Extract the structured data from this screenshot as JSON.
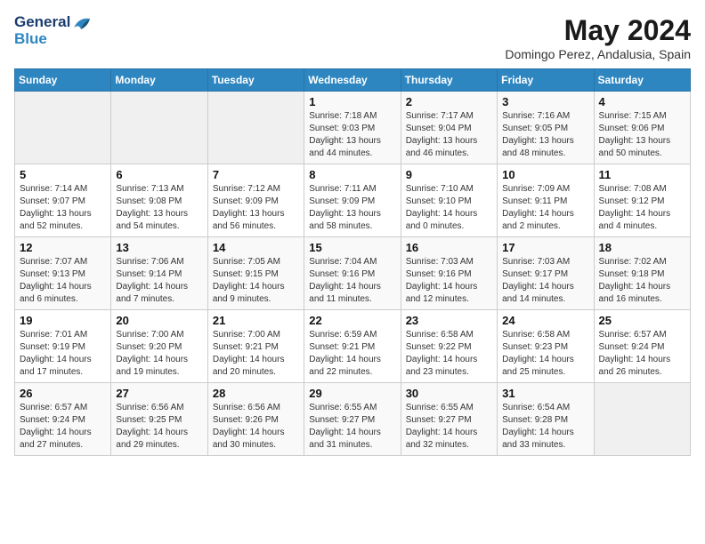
{
  "header": {
    "logo_line1": "General",
    "logo_line2": "Blue",
    "month_title": "May 2024",
    "subtitle": "Domingo Perez, Andalusia, Spain"
  },
  "weekdays": [
    "Sunday",
    "Monday",
    "Tuesday",
    "Wednesday",
    "Thursday",
    "Friday",
    "Saturday"
  ],
  "weeks": [
    [
      {
        "day": "",
        "sunrise": "",
        "sunset": "",
        "daylight": ""
      },
      {
        "day": "",
        "sunrise": "",
        "sunset": "",
        "daylight": ""
      },
      {
        "day": "",
        "sunrise": "",
        "sunset": "",
        "daylight": ""
      },
      {
        "day": "1",
        "sunrise": "Sunrise: 7:18 AM",
        "sunset": "Sunset: 9:03 PM",
        "daylight": "Daylight: 13 hours and 44 minutes."
      },
      {
        "day": "2",
        "sunrise": "Sunrise: 7:17 AM",
        "sunset": "Sunset: 9:04 PM",
        "daylight": "Daylight: 13 hours and 46 minutes."
      },
      {
        "day": "3",
        "sunrise": "Sunrise: 7:16 AM",
        "sunset": "Sunset: 9:05 PM",
        "daylight": "Daylight: 13 hours and 48 minutes."
      },
      {
        "day": "4",
        "sunrise": "Sunrise: 7:15 AM",
        "sunset": "Sunset: 9:06 PM",
        "daylight": "Daylight: 13 hours and 50 minutes."
      }
    ],
    [
      {
        "day": "5",
        "sunrise": "Sunrise: 7:14 AM",
        "sunset": "Sunset: 9:07 PM",
        "daylight": "Daylight: 13 hours and 52 minutes."
      },
      {
        "day": "6",
        "sunrise": "Sunrise: 7:13 AM",
        "sunset": "Sunset: 9:08 PM",
        "daylight": "Daylight: 13 hours and 54 minutes."
      },
      {
        "day": "7",
        "sunrise": "Sunrise: 7:12 AM",
        "sunset": "Sunset: 9:09 PM",
        "daylight": "Daylight: 13 hours and 56 minutes."
      },
      {
        "day": "8",
        "sunrise": "Sunrise: 7:11 AM",
        "sunset": "Sunset: 9:09 PM",
        "daylight": "Daylight: 13 hours and 58 minutes."
      },
      {
        "day": "9",
        "sunrise": "Sunrise: 7:10 AM",
        "sunset": "Sunset: 9:10 PM",
        "daylight": "Daylight: 14 hours and 0 minutes."
      },
      {
        "day": "10",
        "sunrise": "Sunrise: 7:09 AM",
        "sunset": "Sunset: 9:11 PM",
        "daylight": "Daylight: 14 hours and 2 minutes."
      },
      {
        "day": "11",
        "sunrise": "Sunrise: 7:08 AM",
        "sunset": "Sunset: 9:12 PM",
        "daylight": "Daylight: 14 hours and 4 minutes."
      }
    ],
    [
      {
        "day": "12",
        "sunrise": "Sunrise: 7:07 AM",
        "sunset": "Sunset: 9:13 PM",
        "daylight": "Daylight: 14 hours and 6 minutes."
      },
      {
        "day": "13",
        "sunrise": "Sunrise: 7:06 AM",
        "sunset": "Sunset: 9:14 PM",
        "daylight": "Daylight: 14 hours and 7 minutes."
      },
      {
        "day": "14",
        "sunrise": "Sunrise: 7:05 AM",
        "sunset": "Sunset: 9:15 PM",
        "daylight": "Daylight: 14 hours and 9 minutes."
      },
      {
        "day": "15",
        "sunrise": "Sunrise: 7:04 AM",
        "sunset": "Sunset: 9:16 PM",
        "daylight": "Daylight: 14 hours and 11 minutes."
      },
      {
        "day": "16",
        "sunrise": "Sunrise: 7:03 AM",
        "sunset": "Sunset: 9:16 PM",
        "daylight": "Daylight: 14 hours and 12 minutes."
      },
      {
        "day": "17",
        "sunrise": "Sunrise: 7:03 AM",
        "sunset": "Sunset: 9:17 PM",
        "daylight": "Daylight: 14 hours and 14 minutes."
      },
      {
        "day": "18",
        "sunrise": "Sunrise: 7:02 AM",
        "sunset": "Sunset: 9:18 PM",
        "daylight": "Daylight: 14 hours and 16 minutes."
      }
    ],
    [
      {
        "day": "19",
        "sunrise": "Sunrise: 7:01 AM",
        "sunset": "Sunset: 9:19 PM",
        "daylight": "Daylight: 14 hours and 17 minutes."
      },
      {
        "day": "20",
        "sunrise": "Sunrise: 7:00 AM",
        "sunset": "Sunset: 9:20 PM",
        "daylight": "Daylight: 14 hours and 19 minutes."
      },
      {
        "day": "21",
        "sunrise": "Sunrise: 7:00 AM",
        "sunset": "Sunset: 9:21 PM",
        "daylight": "Daylight: 14 hours and 20 minutes."
      },
      {
        "day": "22",
        "sunrise": "Sunrise: 6:59 AM",
        "sunset": "Sunset: 9:21 PM",
        "daylight": "Daylight: 14 hours and 22 minutes."
      },
      {
        "day": "23",
        "sunrise": "Sunrise: 6:58 AM",
        "sunset": "Sunset: 9:22 PM",
        "daylight": "Daylight: 14 hours and 23 minutes."
      },
      {
        "day": "24",
        "sunrise": "Sunrise: 6:58 AM",
        "sunset": "Sunset: 9:23 PM",
        "daylight": "Daylight: 14 hours and 25 minutes."
      },
      {
        "day": "25",
        "sunrise": "Sunrise: 6:57 AM",
        "sunset": "Sunset: 9:24 PM",
        "daylight": "Daylight: 14 hours and 26 minutes."
      }
    ],
    [
      {
        "day": "26",
        "sunrise": "Sunrise: 6:57 AM",
        "sunset": "Sunset: 9:24 PM",
        "daylight": "Daylight: 14 hours and 27 minutes."
      },
      {
        "day": "27",
        "sunrise": "Sunrise: 6:56 AM",
        "sunset": "Sunset: 9:25 PM",
        "daylight": "Daylight: 14 hours and 29 minutes."
      },
      {
        "day": "28",
        "sunrise": "Sunrise: 6:56 AM",
        "sunset": "Sunset: 9:26 PM",
        "daylight": "Daylight: 14 hours and 30 minutes."
      },
      {
        "day": "29",
        "sunrise": "Sunrise: 6:55 AM",
        "sunset": "Sunset: 9:27 PM",
        "daylight": "Daylight: 14 hours and 31 minutes."
      },
      {
        "day": "30",
        "sunrise": "Sunrise: 6:55 AM",
        "sunset": "Sunset: 9:27 PM",
        "daylight": "Daylight: 14 hours and 32 minutes."
      },
      {
        "day": "31",
        "sunrise": "Sunrise: 6:54 AM",
        "sunset": "Sunset: 9:28 PM",
        "daylight": "Daylight: 14 hours and 33 minutes."
      },
      {
        "day": "",
        "sunrise": "",
        "sunset": "",
        "daylight": ""
      }
    ]
  ]
}
